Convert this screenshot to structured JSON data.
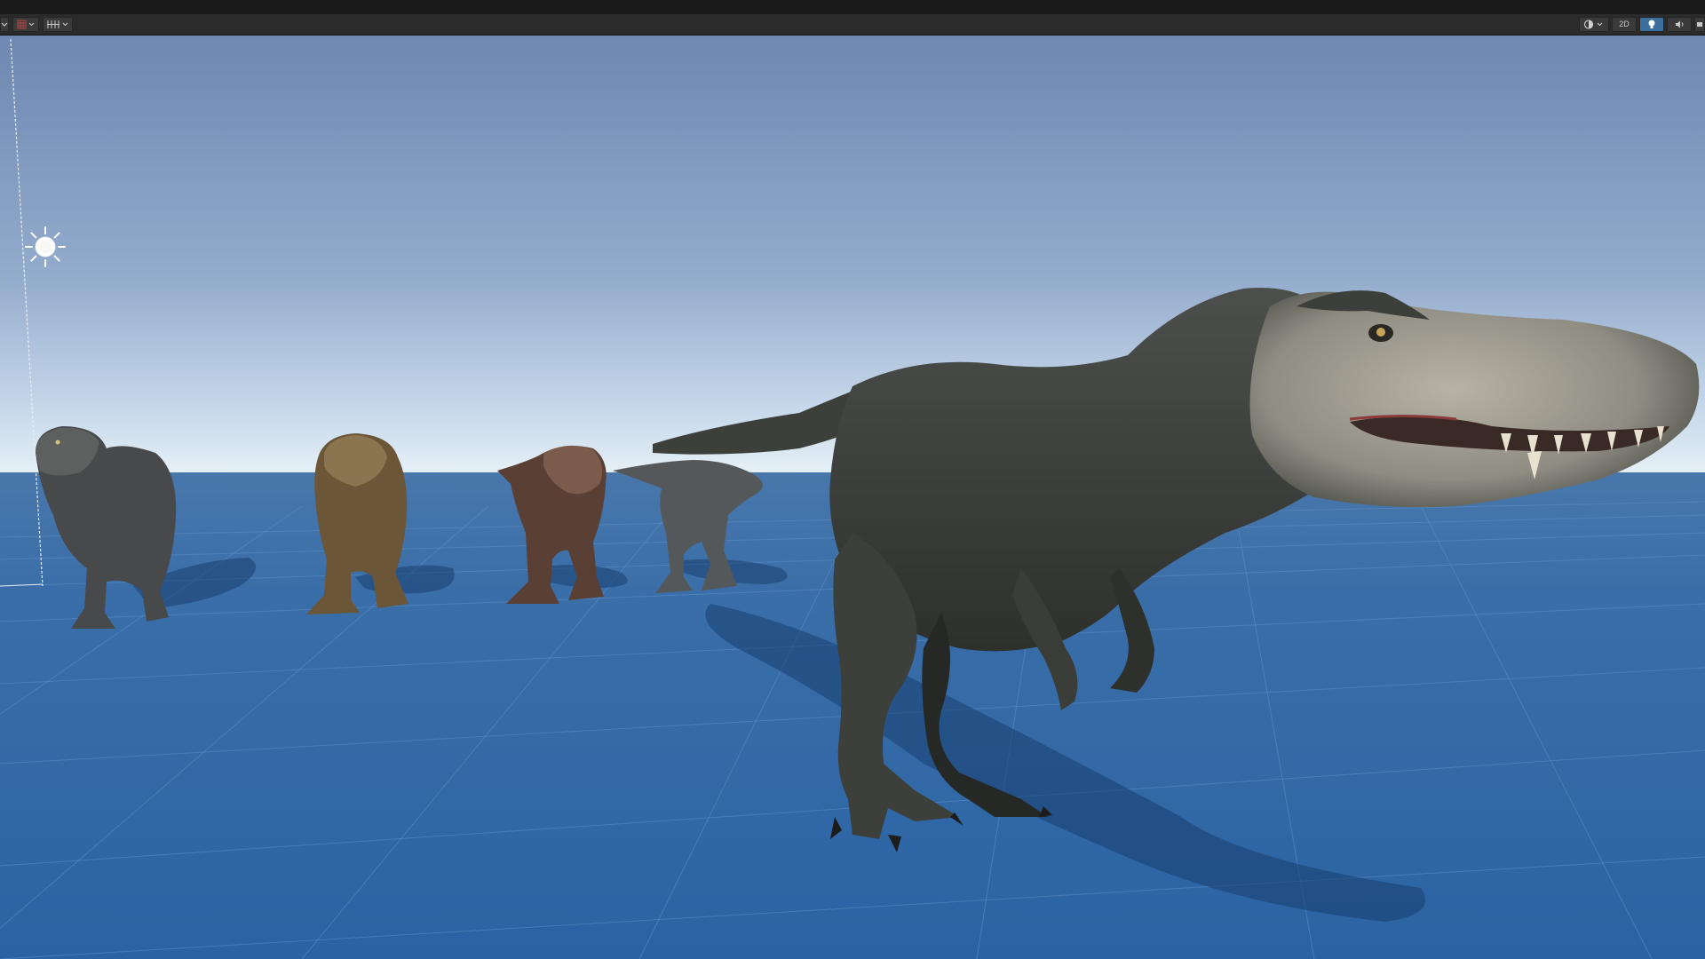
{
  "app": {
    "name": "Scene View",
    "colors": {
      "toolbar_bg": "#2b2b2b",
      "sky_top": "#6f87b1",
      "sky_horizon": "#e3eef6",
      "ground_near": "#2a66a6",
      "ground_far": "#4675a8",
      "grid_line": "#5a8cc3",
      "accent_active": "#3b6f9e"
    }
  },
  "toolbar": {
    "left": [
      {
        "name": "tool-handle-dropdown",
        "icon": "tool-handle-icon"
      },
      {
        "name": "grid-toggle-dropdown",
        "icon": "grid-icon"
      },
      {
        "name": "snap-settings-dropdown",
        "icon": "snap-increment-icon"
      }
    ],
    "right": {
      "shading_icon": "shading-mode-icon",
      "mode_2d_label": "2D",
      "lighting_icon": "lightbulb-icon",
      "audio_icon": "audio-icon",
      "effects_icon": "effects-icon"
    }
  },
  "scene": {
    "directional_light_icon": "sun-icon",
    "dinosaurs": [
      {
        "name": "trex-grey-far-left",
        "color": "#4a4c4e"
      },
      {
        "name": "trex-brown",
        "color": "#6b5638"
      },
      {
        "name": "trex-reddish",
        "color": "#5a3f35"
      },
      {
        "name": "trex-grey-walking",
        "color": "#55585a"
      },
      {
        "name": "trex-closeup",
        "color": "#3b3d3a"
      }
    ]
  }
}
